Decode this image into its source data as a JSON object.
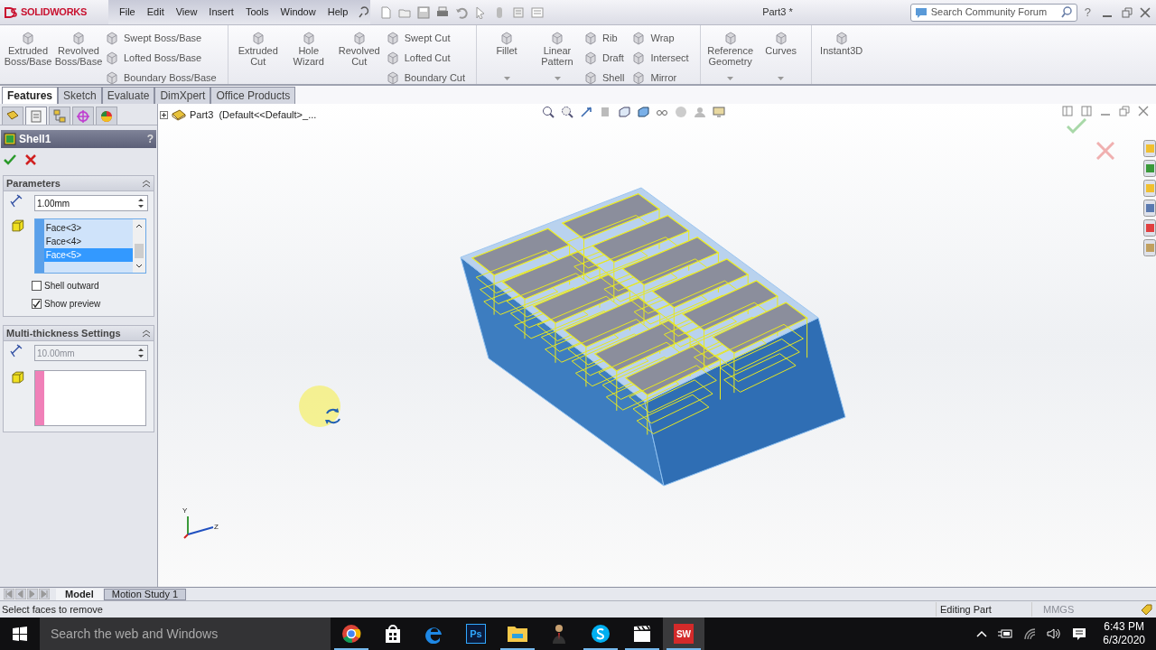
{
  "title_bar": {
    "logo": "SOLIDWORKS",
    "menu": [
      "File",
      "Edit",
      "View",
      "Insert",
      "Tools",
      "Window",
      "Help"
    ],
    "document_title": "Part3 *",
    "search": {
      "placeholder": "Search Community Forum"
    },
    "help": "?"
  },
  "ribbon": {
    "groups": [
      [
        {
          "kind": "large",
          "label": "Extruded Boss/Base",
          "dropdown": false
        },
        {
          "kind": "large",
          "label": "Revolved Boss/Base",
          "dropdown": false
        },
        {
          "kind": "stack",
          "items": [
            "Swept Boss/Base",
            "Lofted Boss/Base",
            "Boundary Boss/Base"
          ]
        }
      ],
      [
        {
          "kind": "large",
          "label": "Extruded Cut",
          "dropdown": false
        },
        {
          "kind": "large",
          "label": "Hole Wizard",
          "dropdown": false
        },
        {
          "kind": "large",
          "label": "Revolved Cut",
          "dropdown": false
        },
        {
          "kind": "stack",
          "items": [
            "Swept Cut",
            "Lofted Cut",
            "Boundary Cut"
          ]
        }
      ],
      [
        {
          "kind": "large",
          "label": "Fillet",
          "dropdown": true
        },
        {
          "kind": "large",
          "label": "Linear Pattern",
          "dropdown": true
        },
        {
          "kind": "stack",
          "items": [
            "Rib",
            "Draft",
            "Shell"
          ]
        },
        {
          "kind": "stack",
          "items": [
            "Wrap",
            "Intersect",
            "Mirror"
          ]
        }
      ],
      [
        {
          "kind": "large",
          "label": "Reference Geometry",
          "dropdown": true
        },
        {
          "kind": "large",
          "label": "Curves",
          "dropdown": true
        }
      ],
      [
        {
          "kind": "large",
          "label": "Instant3D",
          "dropdown": false
        }
      ]
    ]
  },
  "tabs": [
    {
      "label": "Features",
      "selected": true
    },
    {
      "label": "Sketch",
      "selected": false
    },
    {
      "label": "Evaluate",
      "selected": false
    },
    {
      "label": "DimXpert",
      "selected": false
    },
    {
      "label": "Office Products",
      "selected": false
    }
  ],
  "manager_tabs": [
    {
      "kind": "tree",
      "selected": false
    },
    {
      "kind": "property",
      "selected": true
    },
    {
      "kind": "config",
      "selected": false
    },
    {
      "kind": "target",
      "selected": false
    },
    {
      "kind": "display",
      "selected": false
    }
  ],
  "property_manager": {
    "title": "Shell1",
    "help": "?",
    "parameters": {
      "title": "Parameters",
      "expanded": true,
      "thickness": "1.00mm",
      "faces": [
        {
          "label": "Face<3>",
          "selected": false
        },
        {
          "label": "Face<4>",
          "selected": false
        },
        {
          "label": "Face<5>",
          "selected": true
        }
      ],
      "options": [
        {
          "label": "Shell outward",
          "checked": false
        },
        {
          "label": "Show preview",
          "checked": true
        }
      ]
    },
    "multi_thickness": {
      "title": "Multi-thickness Settings",
      "expanded": true,
      "thickness": "10.00mm",
      "disabled": true
    }
  },
  "tree_root": {
    "label": "Part3  (Default<<Default>_...",
    "expanded": false
  },
  "triad": {
    "y": "Y",
    "z": "Z"
  },
  "bottom_tabs": [
    {
      "label": "Model",
      "selected": true
    },
    {
      "label": "Motion Study 1",
      "selected": false
    }
  ],
  "status_bar": {
    "message": "Select faces to remove",
    "mode": "Editing Part",
    "units": "MMGS"
  },
  "taskbar": {
    "search": {
      "placeholder": "Search the web and Windows"
    },
    "apps": [
      {
        "kind": "chrome",
        "running": true,
        "active": false
      },
      {
        "kind": "store",
        "running": false,
        "active": false
      },
      {
        "kind": "edge",
        "running": false,
        "active": false
      },
      {
        "kind": "photoshop",
        "text": "Ps",
        "running": false,
        "active": false
      },
      {
        "kind": "folder",
        "running": true,
        "active": false
      },
      {
        "kind": "person",
        "running": false,
        "active": false
      },
      {
        "kind": "skype",
        "running": true,
        "active": false
      },
      {
        "kind": "clapper",
        "running": true,
        "active": false
      },
      {
        "kind": "solidworks",
        "text": "SW",
        "running": true,
        "active": true
      }
    ],
    "time": "6:43 PM",
    "date": "6/3/2020"
  }
}
